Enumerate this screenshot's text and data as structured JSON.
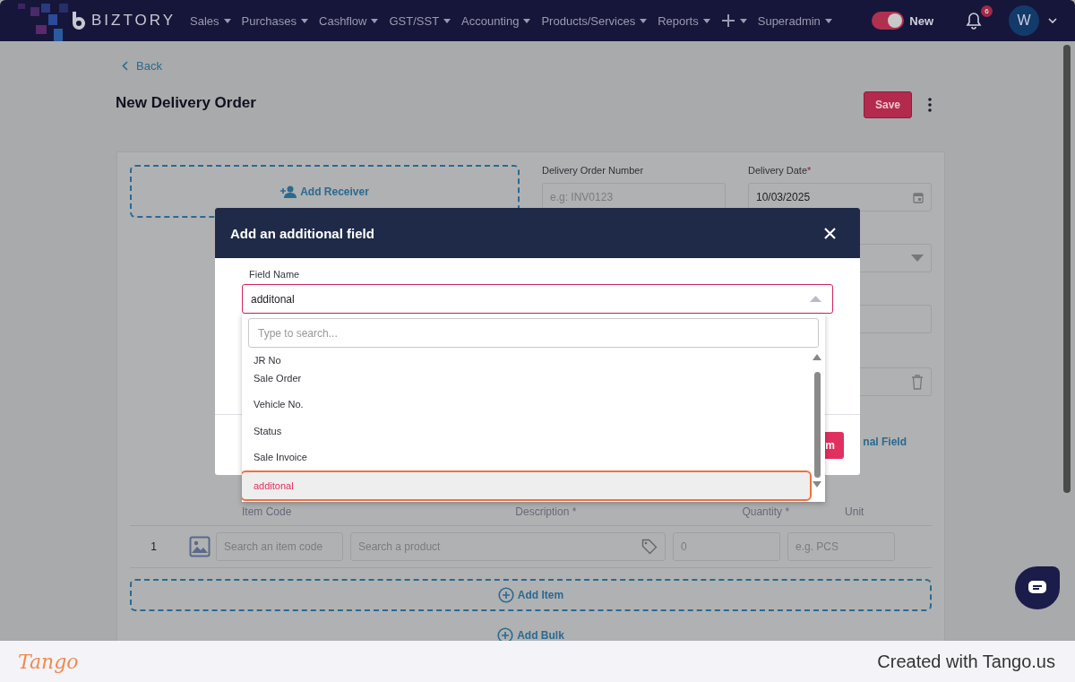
{
  "navbar": {
    "logo": "BIZTORY",
    "menu": [
      {
        "kind": "text",
        "label": "Sales"
      },
      {
        "kind": "text",
        "label": "Purchases"
      },
      {
        "kind": "text",
        "label": "Cashflow"
      },
      {
        "kind": "text",
        "label": "GST/SST"
      },
      {
        "kind": "text",
        "label": "Accounting"
      },
      {
        "kind": "text",
        "label": "Products/Services"
      },
      {
        "kind": "text",
        "label": "Reports"
      },
      {
        "kind": "add"
      },
      {
        "kind": "text",
        "label": "Superadmin"
      }
    ],
    "toggle": {
      "label": "New",
      "on": true
    },
    "notifications": "6",
    "avatar": "W"
  },
  "page": {
    "back": "Back",
    "title": "New Delivery Order",
    "save": "Save",
    "receiver": "Add Receiver",
    "fields": [
      {
        "label": "Delivery Order Number",
        "placeholder": "e.g: INV0123"
      },
      {
        "label": "Delivery Date",
        "required_mark": "*",
        "value": "10/03/2025"
      }
    ],
    "add_field_link": "nal Field",
    "table": {
      "columns": [
        "Item Code",
        "Description *",
        "Quantity *",
        "Unit"
      ],
      "rows": [
        {
          "number": "1",
          "item_code_placeholder": "Search an item code",
          "product_placeholder": "Search a product",
          "quantity": "0",
          "unit_placeholder": "e.g. PCS"
        }
      ]
    },
    "add_item": "Add Item",
    "add_bulk": "Add Bulk"
  },
  "modal": {
    "title": "Add an additional field",
    "field_label": "Field Name",
    "field_value": "additonal",
    "confirm": "m",
    "dropdown": {
      "search_placeholder": "Type to search...",
      "options": [
        {
          "label": "JR No",
          "selected": false
        },
        {
          "label": "Sale Order",
          "selected": false
        },
        {
          "label": "Vehicle No.",
          "selected": false
        },
        {
          "label": "Status",
          "selected": false
        },
        {
          "label": "Sale Invoice",
          "selected": false
        },
        {
          "label": "additonal",
          "selected": true
        }
      ]
    }
  },
  "footer": {
    "logo": "Tango",
    "text": "Created with Tango.us"
  }
}
